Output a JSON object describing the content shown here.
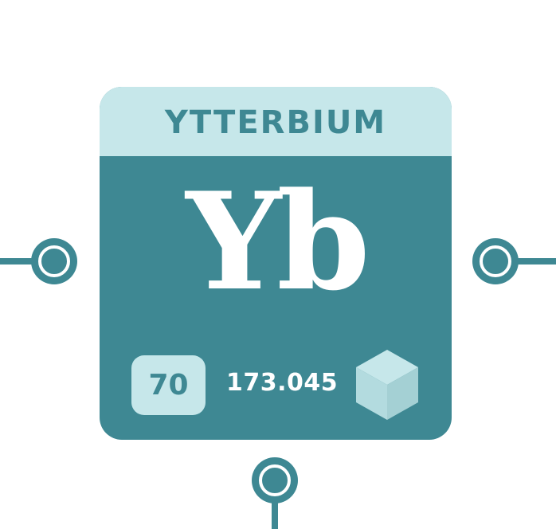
{
  "element": {
    "name": "YTTERBIUM",
    "symbol": "Yb",
    "atomic_number": "70",
    "atomic_mass": "173.045"
  },
  "icons": {
    "crystal_structure": "cube-icon",
    "connectors": [
      "connector-node-icon",
      "connector-node-icon",
      "connector-node-icon"
    ]
  },
  "colors": {
    "primary_teal": "#3e8893",
    "light_teal": "#c6e7ea",
    "text_white": "#ffffff",
    "cube_light": "#c6e7ea",
    "cube_mid": "#b3dbdf",
    "cube_dark": "#a4d0d4"
  }
}
